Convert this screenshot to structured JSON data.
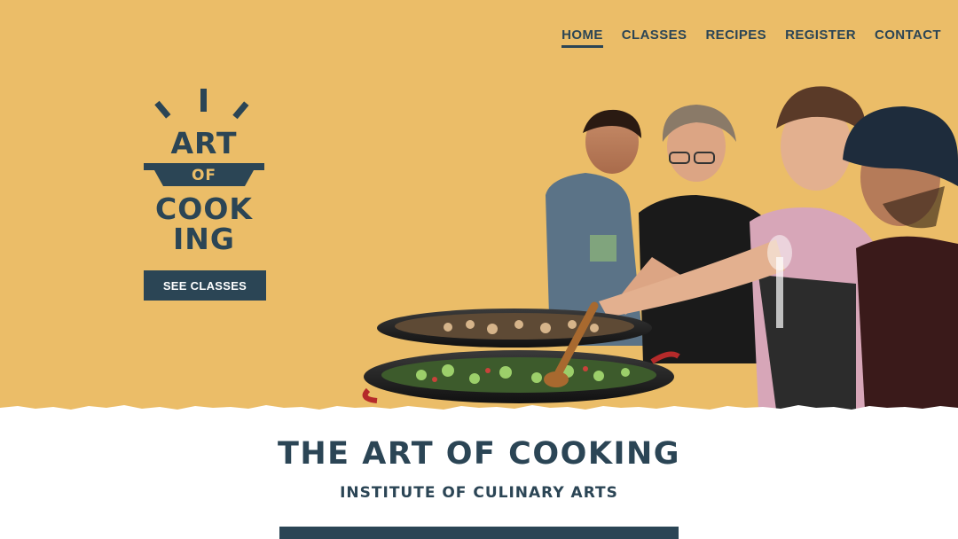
{
  "nav": {
    "items": [
      {
        "label": "HOME",
        "active": true
      },
      {
        "label": "CLASSES",
        "active": false
      },
      {
        "label": "RECIPES",
        "active": false
      },
      {
        "label": "REGISTER",
        "active": false
      },
      {
        "label": "CONTACT",
        "active": false
      }
    ]
  },
  "logo": {
    "line1": "ART",
    "line2": "OF",
    "line3": "COOK",
    "line4": "ING"
  },
  "hero": {
    "button_label": "SEE CLASSES",
    "photo_icon": "cooking-class-photo"
  },
  "content": {
    "title": "THE ART OF COOKING",
    "subtitle": "INSTITUTE OF CULINARY ARTS"
  },
  "colors": {
    "hero_background": "#ebbd68",
    "primary_navy": "#2b4555",
    "page_background": "#ffffff"
  }
}
